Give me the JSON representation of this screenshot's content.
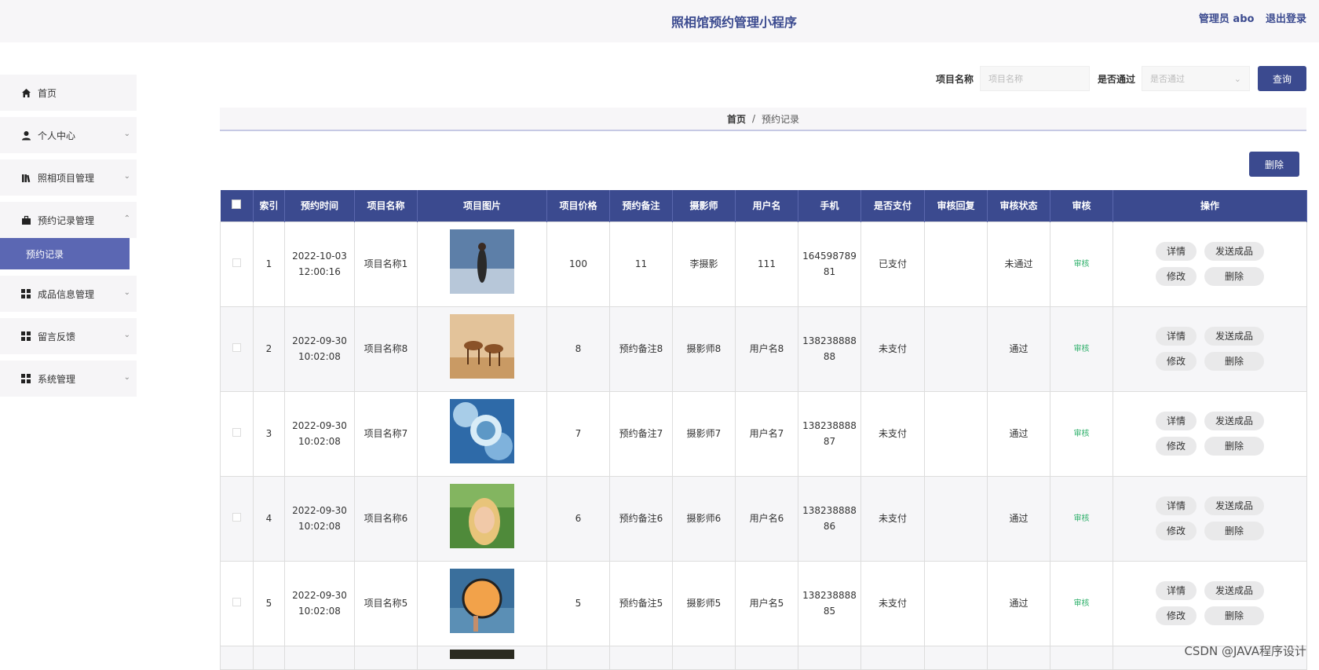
{
  "header": {
    "title": "照相馆预约管理小程序",
    "user": "管理员 abo",
    "logout": "退出登录"
  },
  "sidebar": {
    "items": [
      {
        "label": "首页",
        "icon": "home-icon"
      },
      {
        "label": "个人中心",
        "icon": "user-icon"
      },
      {
        "label": "照相项目管理",
        "icon": "book-icon"
      },
      {
        "label": "预约记录管理",
        "icon": "briefcase-icon",
        "sub": "预约记录"
      },
      {
        "label": "成品信息管理",
        "icon": "grid-icon"
      },
      {
        "label": "留言反馈",
        "icon": "grid-icon"
      },
      {
        "label": "系统管理",
        "icon": "grid-icon"
      }
    ]
  },
  "search": {
    "name_label": "项目名称",
    "name_placeholder": "项目名称",
    "pass_label": "是否通过",
    "pass_placeholder": "是否通过",
    "query_button": "查询"
  },
  "breadcrumb": {
    "home": "首页",
    "sep": "/",
    "current": "预约记录"
  },
  "toolbar": {
    "delete_button": "删除"
  },
  "table": {
    "columns": [
      "",
      "索引",
      "预约时间",
      "项目名称",
      "项目图片",
      "项目价格",
      "预约备注",
      "摄影师",
      "用户名",
      "手机",
      "是否支付",
      "审核回复",
      "审核状态",
      "审核",
      "操作"
    ],
    "actions": {
      "detail": "详情",
      "send": "发送成品",
      "edit": "修改",
      "delete": "删除"
    },
    "audit_label": "审核",
    "rows": [
      {
        "index": "1",
        "time": "2022-10-03 12:00:16",
        "name": "项目名称1",
        "price": "100",
        "remark": "11",
        "photographer": "李摄影",
        "username": "111",
        "phone": "16459878981",
        "paid": "已支付",
        "reply": "",
        "status": "未通过"
      },
      {
        "index": "2",
        "time": "2022-09-30 10:02:08",
        "name": "项目名称8",
        "price": "8",
        "remark": "预约备注8",
        "photographer": "摄影师8",
        "username": "用户名8",
        "phone": "13823888888",
        "paid": "未支付",
        "reply": "",
        "status": "通过"
      },
      {
        "index": "3",
        "time": "2022-09-30 10:02:08",
        "name": "项目名称7",
        "price": "7",
        "remark": "预约备注7",
        "photographer": "摄影师7",
        "username": "用户名7",
        "phone": "13823888887",
        "paid": "未支付",
        "reply": "",
        "status": "通过"
      },
      {
        "index": "4",
        "time": "2022-09-30 10:02:08",
        "name": "项目名称6",
        "price": "6",
        "remark": "预约备注6",
        "photographer": "摄影师6",
        "username": "用户名6",
        "phone": "13823888886",
        "paid": "未支付",
        "reply": "",
        "status": "通过"
      },
      {
        "index": "5",
        "time": "2022-09-30 10:02:08",
        "name": "项目名称5",
        "price": "5",
        "remark": "预约备注5",
        "photographer": "摄影师5",
        "username": "用户名5",
        "phone": "13823888885",
        "paid": "未支付",
        "reply": "",
        "status": "通过"
      }
    ]
  },
  "watermark": "CSDN @JAVA程序设计"
}
